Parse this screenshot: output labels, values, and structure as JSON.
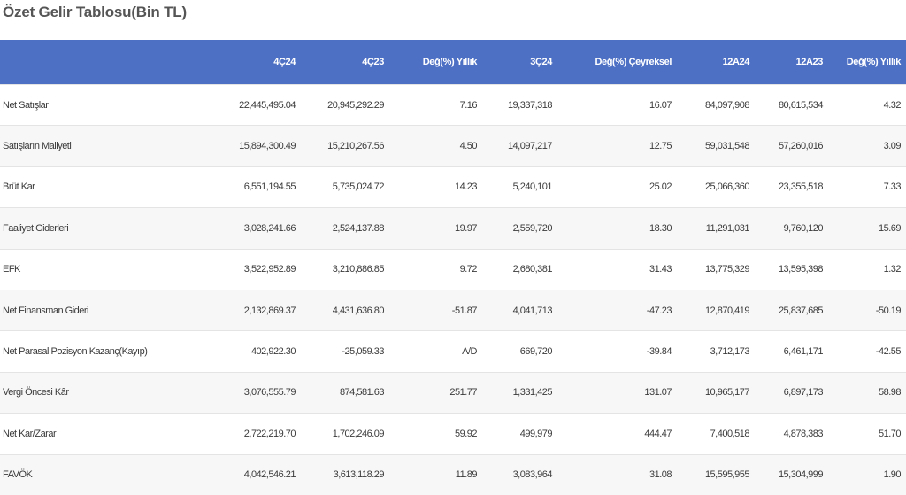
{
  "title": "Özet Gelir Tablosu(Bin TL)",
  "columns": [
    "",
    "4Ç24",
    "4Ç23",
    "Değ(%) Yıllık",
    "3Ç24",
    "Değ(%) Çeyreksel",
    "12A24",
    "12A23",
    "Değ(%) Yıllık"
  ],
  "rows": [
    [
      "Net Satışlar",
      "22,445,495.04",
      "20,945,292.29",
      "7.16",
      "19,337,318",
      "16.07",
      "84,097,908",
      "80,615,534",
      "4.32"
    ],
    [
      "Satışların Maliyeti",
      "15,894,300.49",
      "15,210,267.56",
      "4.50",
      "14,097,217",
      "12.75",
      "59,031,548",
      "57,260,016",
      "3.09"
    ],
    [
      "Brüt Kar",
      "6,551,194.55",
      "5,735,024.72",
      "14.23",
      "5,240,101",
      "25.02",
      "25,066,360",
      "23,355,518",
      "7.33"
    ],
    [
      "Faaliyet Giderleri",
      "3,028,241.66",
      "2,524,137.88",
      "19.97",
      "2,559,720",
      "18.30",
      "11,291,031",
      "9,760,120",
      "15.69"
    ],
    [
      "EFK",
      "3,522,952.89",
      "3,210,886.85",
      "9.72",
      "2,680,381",
      "31.43",
      "13,775,329",
      "13,595,398",
      "1.32"
    ],
    [
      "Net Finansman Gideri",
      "2,132,869.37",
      "4,431,636.80",
      "-51.87",
      "4,041,713",
      "-47.23",
      "12,870,419",
      "25,837,685",
      "-50.19"
    ],
    [
      "Net Parasal Pozisyon Kazanç(Kayıp)",
      "402,922.30",
      "-25,059.33",
      "A/D",
      "669,720",
      "-39.84",
      "3,712,173",
      "6,461,171",
      "-42.55"
    ],
    [
      "Vergi Öncesi Kâr",
      "3,076,555.79",
      "874,581.63",
      "251.77",
      "1,331,425",
      "131.07",
      "10,965,177",
      "6,897,173",
      "58.98"
    ],
    [
      "Net Kar/Zarar",
      "2,722,219.70",
      "1,702,246.09",
      "59.92",
      "499,979",
      "444.47",
      "7,400,518",
      "4,878,383",
      "51.70"
    ],
    [
      "FAVÖK",
      "4,042,546.21",
      "3,613,118.29",
      "11.89",
      "3,083,964",
      "31.08",
      "15,595,955",
      "15,304,999",
      "1.90"
    ]
  ]
}
